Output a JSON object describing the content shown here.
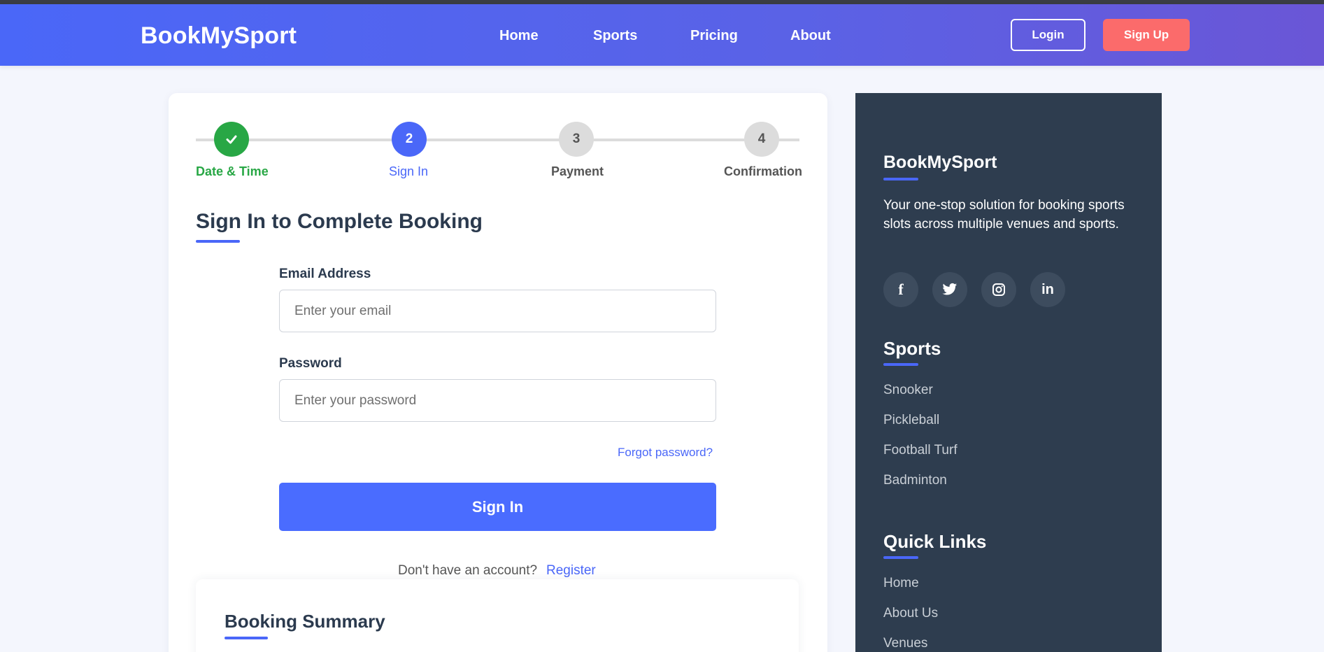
{
  "brand": "BookMySport",
  "nav": {
    "home": "Home",
    "sports": "Sports",
    "pricing": "Pricing",
    "about": "About"
  },
  "auth": {
    "login": "Login",
    "signup": "Sign Up"
  },
  "steps": [
    {
      "number": "✓",
      "label": "Date & Time",
      "state": "completed"
    },
    {
      "number": "2",
      "label": "Sign In",
      "state": "active"
    },
    {
      "number": "3",
      "label": "Payment",
      "state": "pending"
    },
    {
      "number": "4",
      "label": "Confirmation",
      "state": "pending"
    }
  ],
  "form": {
    "title": "Sign In to Complete Booking",
    "email_label": "Email Address",
    "email_placeholder": "Enter your email",
    "email_value": "",
    "password_label": "Password",
    "password_placeholder": "Enter your password",
    "password_value": "",
    "forgot": "Forgot password?",
    "submit": "Sign In",
    "register_prompt": "Don't have an account?",
    "register_link": "Register"
  },
  "summary": {
    "title": "Booking Summary"
  },
  "sidebar": {
    "brand": "BookMySport",
    "description": "Your one-stop solution for booking sports slots across multiple venues and sports.",
    "social": [
      "facebook-icon",
      "twitter-icon",
      "instagram-icon",
      "linkedin-icon"
    ],
    "sports_heading": "Sports",
    "sports": [
      "Snooker",
      "Pickleball",
      "Football Turf",
      "Badminton"
    ],
    "quick_links_heading": "Quick Links",
    "quick_links": [
      "Home",
      "About Us",
      "Venues"
    ]
  },
  "colors": {
    "primary": "#4a67f8",
    "success": "#28a745",
    "signup": "#fb6b6b",
    "sidebar_bg": "#2e3d4f",
    "pending_step": "#dcdcdc"
  }
}
